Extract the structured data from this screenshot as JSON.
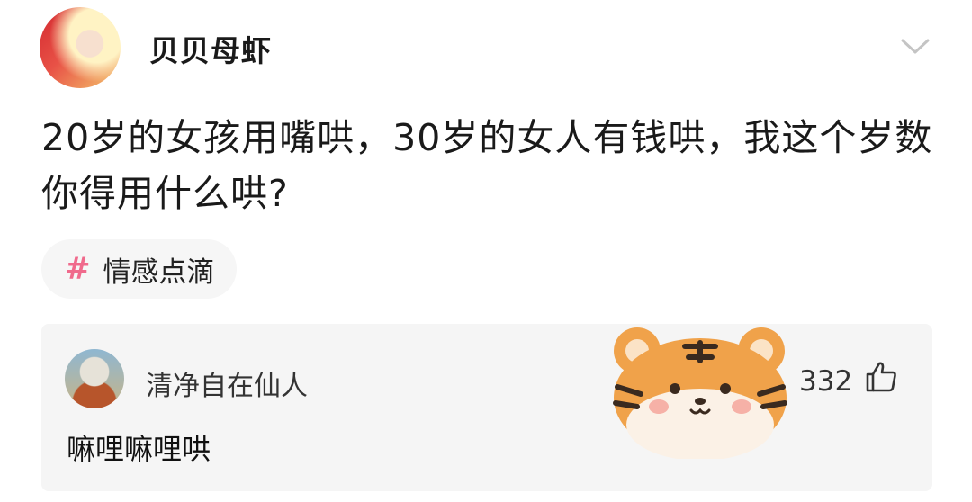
{
  "post": {
    "author": "贝贝母虾",
    "text": "20岁的女孩用嘴哄，30岁的女人有钱哄，我这个岁数你得用什么哄?",
    "topic": {
      "hash": "#",
      "label": "情感点滴"
    }
  },
  "comment": {
    "username": "清净自在仙人",
    "text": "嘛哩嘛哩哄",
    "likes": "332"
  },
  "icons": {
    "expand": "chevron-down-icon",
    "like": "thumbs-up-icon",
    "sticker": "tiger-sticker"
  },
  "colors": {
    "topic_hash": "#f06a8c",
    "card_bg": "#f5f5f5",
    "tiger_orange": "#f0a24a"
  }
}
